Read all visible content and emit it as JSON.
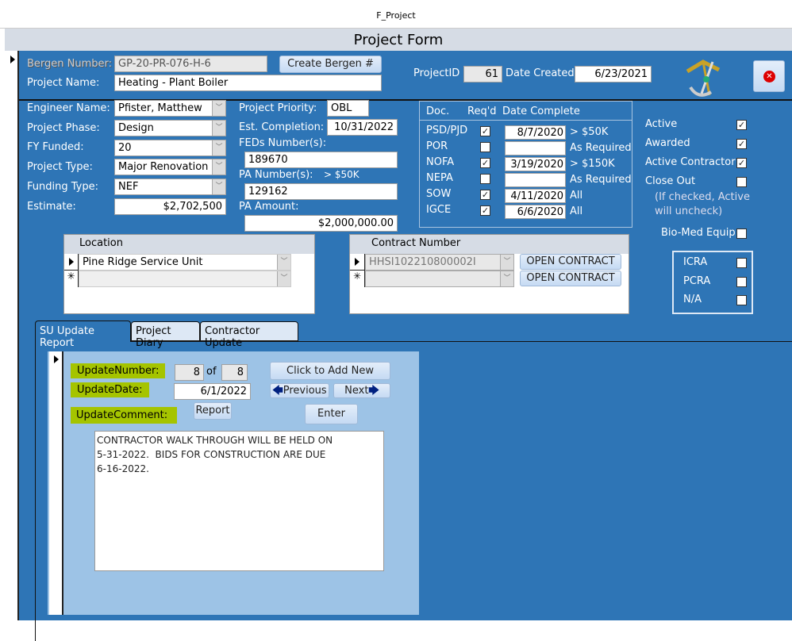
{
  "window": {
    "title": "F_Project"
  },
  "header": {
    "title": "Project Form"
  },
  "top": {
    "bergen_label": "Bergen Number:",
    "bergen_value": "GP-20-PR-076-H-6",
    "create_bergen": "Create Bergen #",
    "name_label": "Project Name:",
    "name_value": "Heating - Plant Boiler",
    "projectid_label": "ProjectID",
    "projectid_value": "61",
    "created_label": "Date Created:",
    "created_value": "6/23/2021"
  },
  "left": {
    "engineer_label": "Engineer Name:",
    "engineer_value": "Pfister,  Matthew",
    "phase_label": "Project Phase:",
    "phase_value": "Design",
    "fy_label": "FY Funded:",
    "fy_value": "20",
    "type_label": "Project Type:",
    "type_value": "Major Renovation",
    "funding_label": "Funding Type:",
    "funding_value": "NEF",
    "estimate_label": "Estimate:",
    "estimate_value": "$2,702,500"
  },
  "mid": {
    "priority_label": "Project Priority:",
    "priority_value": "OBL",
    "completion_label": "Est. Completion:",
    "completion_value": "10/31/2022",
    "feds_label": "FEDs Number(s):",
    "feds_value": "189670",
    "pa_label": "PA Number(s):",
    "pa_note": "> $50K",
    "pa_value": "129162",
    "amount_label": "PA Amount:",
    "amount_value": "$2,000,000.00"
  },
  "docs": {
    "col_doc": "Doc.",
    "col_req": "Req'd",
    "col_date": "Date Complete",
    "rows": [
      {
        "doc": "PSD/PJD",
        "req": true,
        "date": "8/7/2020",
        "note": "> $50K"
      },
      {
        "doc": "POR",
        "req": false,
        "date": "",
        "note": "As Required"
      },
      {
        "doc": "NOFA",
        "req": true,
        "date": "3/19/2020",
        "note": "> $150K"
      },
      {
        "doc": "NEPA",
        "req": false,
        "date": "",
        "note": "As Required"
      },
      {
        "doc": "SOW",
        "req": true,
        "date": "4/11/2020",
        "note": "All"
      },
      {
        "doc": "IGCE",
        "req": true,
        "date": "6/6/2020",
        "note": "All"
      }
    ]
  },
  "status": {
    "active": "Active",
    "awarded": "Awarded",
    "active_contractor": "Active Contractor",
    "close_out": "Close Out",
    "close_note1": "(If checked, Active",
    "close_note2": "will uncheck)",
    "biomed": "Bio-Med Equip",
    "icra": "ICRA",
    "pcra": "PCRA",
    "na": "N/A",
    "checks": {
      "active": true,
      "awarded": true,
      "active_contractor": true,
      "close_out": false,
      "biomed": false,
      "icra": false,
      "pcra": false,
      "na": false
    }
  },
  "location": {
    "header": "Location",
    "rows": [
      "Pine Ridge Service Unit",
      ""
    ]
  },
  "contract": {
    "header": "Contract Number",
    "rows": [
      "HHSI102210800002I",
      ""
    ],
    "open_label": "OPEN CONTRACT"
  },
  "tabs": [
    "SU Update Report",
    "Project Diary",
    "Contractor Update"
  ],
  "update": {
    "number_label": "UpdateNumber:",
    "number_value": "8",
    "of_label": "of",
    "total_value": "8",
    "date_label": "UpdateDate:",
    "date_value": "6/1/2022",
    "comment_label": "UpdateComment:",
    "report": "Report",
    "add_new": "Click to Add New",
    "previous": "Previous",
    "next": "Next",
    "enter": "Enter",
    "comment": "CONTRACTOR WALK THROUGH WILL BE HELD ON\n5-31-2022.  BIDS FOR CONSTRUCTION ARE DUE\n6-16-2022."
  },
  "colors": {
    "form_bg": "#2e75b6",
    "subform_bg": "#9dc3e6",
    "highlight": "#a5c400"
  }
}
